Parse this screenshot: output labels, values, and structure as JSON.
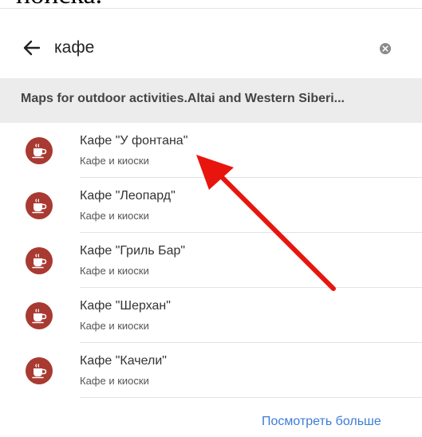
{
  "caption": "поиска.",
  "search": {
    "query": "кафе"
  },
  "map_banner": {
    "label": "Maps for outdoor activities.Altai and Western Siberi..."
  },
  "results": [
    {
      "title": "Кафе \"У фонтана\"",
      "category": "Кафе и киоски",
      "icon": "cafe-cup-icon"
    },
    {
      "title": "Кафе \"Леопард\"",
      "category": "Кафе и киоски",
      "icon": "cafe-cup-icon"
    },
    {
      "title": "Кафе \"Гриль Бар\"",
      "category": "Кафе и киоски",
      "icon": "cafe-cup-icon"
    },
    {
      "title": "Кафе \"Шерхан\"",
      "category": "Кафе и киоски",
      "icon": "cafe-cup-icon"
    },
    {
      "title": "Кафе \"Качели\"",
      "category": "Кафе и киоски",
      "icon": "cafe-cup-icon"
    }
  ],
  "footer": {
    "see_more": "Посмотреть больше"
  },
  "colors": {
    "icon_bg": "#a83a32",
    "arrow": "#e8150e",
    "link": "#3b7dd8",
    "banner_bg": "#ececec"
  }
}
